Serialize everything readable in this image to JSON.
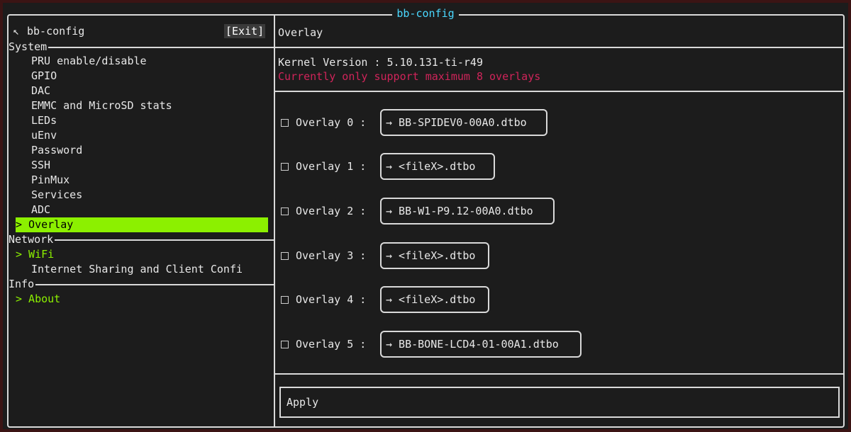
{
  "title": "bb-config",
  "sidebar": {
    "header_icon": "↖",
    "header_label": "bb-config",
    "exit_label": "[Exit]",
    "sections": [
      {
        "label": "System",
        "items": [
          "PRU enable/disable",
          "GPIO",
          "DAC",
          "EMMC and MicroSD stats",
          "LEDs",
          "uEnv",
          "Password",
          "SSH",
          "PinMux",
          "Services",
          "ADC",
          "> Overlay"
        ]
      },
      {
        "label": "Network",
        "items": [
          "> WiFi",
          "Internet Sharing and Client Confi"
        ]
      },
      {
        "label": "Info",
        "items": [
          "> About"
        ]
      }
    ]
  },
  "main": {
    "header": "Overlay",
    "kernel": "Kernel Version : 5.10.131-ti-r49",
    "warning": "Currently only support maximum 8 overlays",
    "overlays": [
      {
        "label": "Overlay 0 :",
        "file": "→ BB-SPIDEV0-00A0.dtbo"
      },
      {
        "label": "Overlay 1 :",
        "file": "→ <fileX>.dtbo"
      },
      {
        "label": "Overlay 2 :",
        "file": "→ BB-W1-P9.12-00A0.dtbo"
      },
      {
        "label": "Overlay 3 :",
        "file": "→ <fileX>.dtbo"
      },
      {
        "label": "Overlay 4 :",
        "file": "→ <fileX>.dtbo"
      },
      {
        "label": "Overlay 5 :",
        "file": "→ BB-BONE-LCD4-01-00A1.dtbo"
      }
    ],
    "apply_label": "Apply"
  },
  "colors": {
    "title": "#4ad8ff",
    "accent": "#8cf000",
    "warning": "#d0245a"
  }
}
